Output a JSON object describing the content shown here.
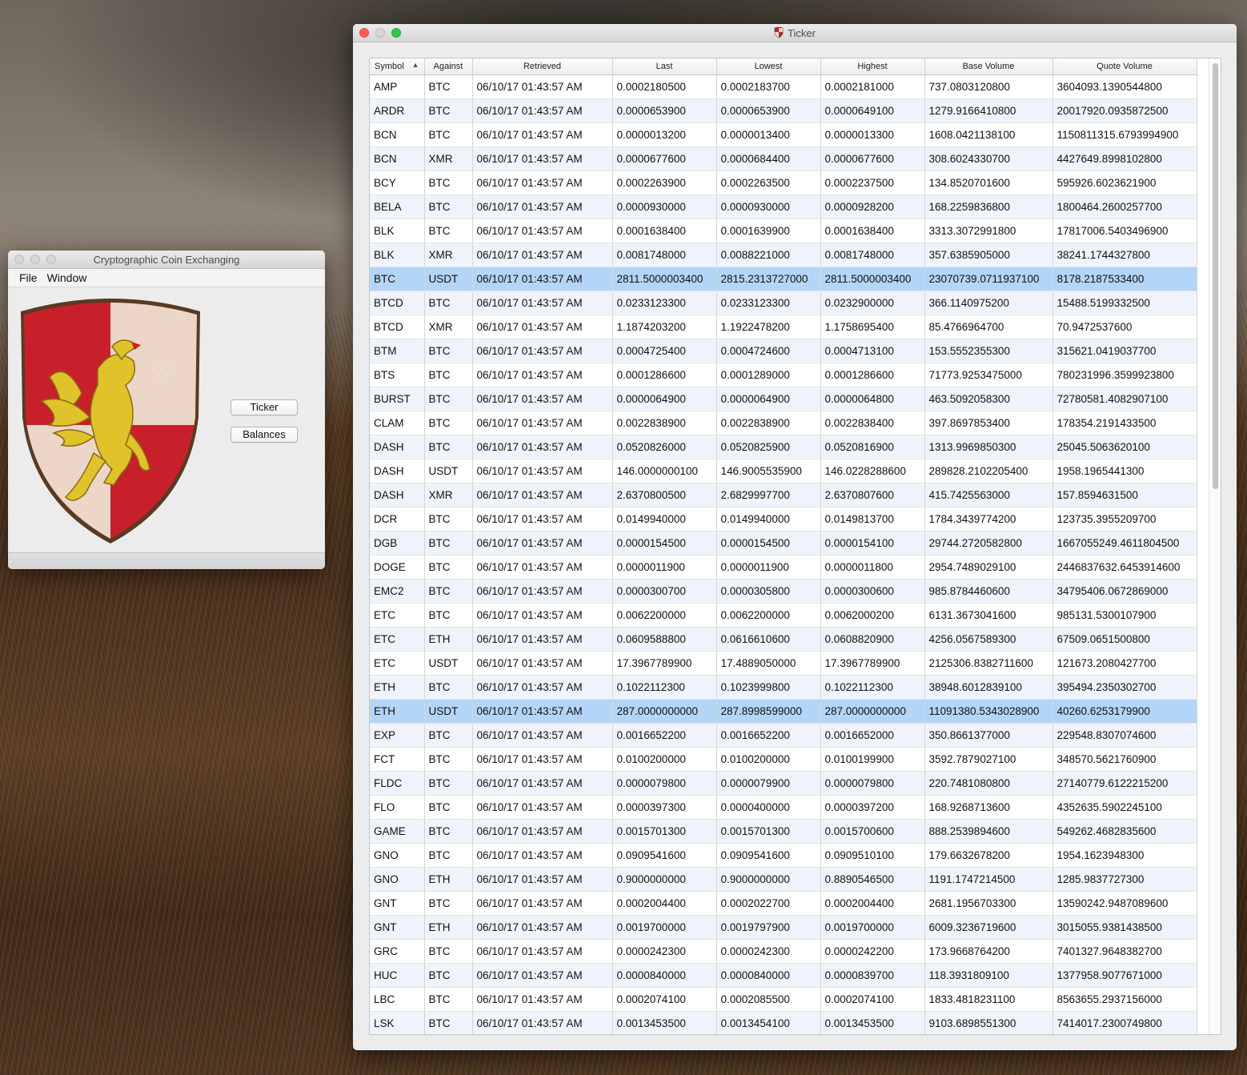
{
  "main_window": {
    "title": "Cryptographic Coin Exchanging",
    "menu": [
      "File",
      "Window"
    ],
    "buttons": {
      "ticker": "Ticker",
      "balances": "Balances"
    }
  },
  "ticker_window": {
    "title": "Ticker",
    "columns": [
      "Symbol",
      "Against",
      "Retrieved",
      "Last",
      "Lowest",
      "Highest",
      "Base Volume",
      "Quote Volume"
    ],
    "sort_indicator": "▲",
    "rows": [
      [
        "AMP",
        "BTC",
        "06/10/17 01:43:57 AM",
        "0.0002180500",
        "0.0002183700",
        "0.0002181000",
        "737.0803120800",
        "3604093.1390544800"
      ],
      [
        "ARDR",
        "BTC",
        "06/10/17 01:43:57 AM",
        "0.0000653900",
        "0.0000653900",
        "0.0000649100",
        "1279.9166410800",
        "20017920.0935872500"
      ],
      [
        "BCN",
        "BTC",
        "06/10/17 01:43:57 AM",
        "0.0000013200",
        "0.0000013400",
        "0.0000013300",
        "1608.0421138100",
        "1150811315.6793994900"
      ],
      [
        "BCN",
        "XMR",
        "06/10/17 01:43:57 AM",
        "0.0000677600",
        "0.0000684400",
        "0.0000677600",
        "308.6024330700",
        "4427649.8998102800"
      ],
      [
        "BCY",
        "BTC",
        "06/10/17 01:43:57 AM",
        "0.0002263900",
        "0.0002263500",
        "0.0002237500",
        "134.8520701600",
        "595926.6023621900"
      ],
      [
        "BELA",
        "BTC",
        "06/10/17 01:43:57 AM",
        "0.0000930000",
        "0.0000930000",
        "0.0000928200",
        "168.2259836800",
        "1800464.2600257700"
      ],
      [
        "BLK",
        "BTC",
        "06/10/17 01:43:57 AM",
        "0.0001638400",
        "0.0001639900",
        "0.0001638400",
        "3313.3072991800",
        "17817006.5403496900"
      ],
      [
        "BLK",
        "XMR",
        "06/10/17 01:43:57 AM",
        "0.0081748000",
        "0.0088221000",
        "0.0081748000",
        "357.6385905000",
        "38241.1744327800"
      ],
      [
        "BTC",
        "USDT",
        "06/10/17 01:43:57 AM",
        "2811.5000003400",
        "2815.2313727000",
        "2811.5000003400",
        "23070739.0711937100",
        "8178.2187533400"
      ],
      [
        "BTCD",
        "BTC",
        "06/10/17 01:43:57 AM",
        "0.0233123300",
        "0.0233123300",
        "0.0232900000",
        "366.1140975200",
        "15488.5199332500"
      ],
      [
        "BTCD",
        "XMR",
        "06/10/17 01:43:57 AM",
        "1.1874203200",
        "1.1922478200",
        "1.1758695400",
        "85.4766964700",
        "70.9472537600"
      ],
      [
        "BTM",
        "BTC",
        "06/10/17 01:43:57 AM",
        "0.0004725400",
        "0.0004724600",
        "0.0004713100",
        "153.5552355300",
        "315621.0419037700"
      ],
      [
        "BTS",
        "BTC",
        "06/10/17 01:43:57 AM",
        "0.0001286600",
        "0.0001289000",
        "0.0001286600",
        "71773.9253475000",
        "780231996.3599923800"
      ],
      [
        "BURST",
        "BTC",
        "06/10/17 01:43:57 AM",
        "0.0000064900",
        "0.0000064900",
        "0.0000064800",
        "463.5092058300",
        "72780581.4082907100"
      ],
      [
        "CLAM",
        "BTC",
        "06/10/17 01:43:57 AM",
        "0.0022838900",
        "0.0022838900",
        "0.0022838400",
        "397.8697853400",
        "178354.2191433500"
      ],
      [
        "DASH",
        "BTC",
        "06/10/17 01:43:57 AM",
        "0.0520826000",
        "0.0520825900",
        "0.0520816900",
        "1313.9969850300",
        "25045.5063620100"
      ],
      [
        "DASH",
        "USDT",
        "06/10/17 01:43:57 AM",
        "146.0000000100",
        "146.9005535900",
        "146.0228288600",
        "289828.2102205400",
        "1958.1965441300"
      ],
      [
        "DASH",
        "XMR",
        "06/10/17 01:43:57 AM",
        "2.6370800500",
        "2.6829997700",
        "2.6370807600",
        "415.7425563000",
        "157.8594631500"
      ],
      [
        "DCR",
        "BTC",
        "06/10/17 01:43:57 AM",
        "0.0149940000",
        "0.0149940000",
        "0.0149813700",
        "1784.3439774200",
        "123735.3955209700"
      ],
      [
        "DGB",
        "BTC",
        "06/10/17 01:43:57 AM",
        "0.0000154500",
        "0.0000154500",
        "0.0000154100",
        "29744.2720582800",
        "1667055249.4611804500"
      ],
      [
        "DOGE",
        "BTC",
        "06/10/17 01:43:57 AM",
        "0.0000011900",
        "0.0000011900",
        "0.0000011800",
        "2954.7489029100",
        "2446837632.6453914600"
      ],
      [
        "EMC2",
        "BTC",
        "06/10/17 01:43:57 AM",
        "0.0000300700",
        "0.0000305800",
        "0.0000300600",
        "985.8784460600",
        "34795406.0672869000"
      ],
      [
        "ETC",
        "BTC",
        "06/10/17 01:43:57 AM",
        "0.0062200000",
        "0.0062200000",
        "0.0062000200",
        "6131.3673041600",
        "985131.5300107900"
      ],
      [
        "ETC",
        "ETH",
        "06/10/17 01:43:57 AM",
        "0.0609588800",
        "0.0616610600",
        "0.0608820900",
        "4256.0567589300",
        "67509.0651500800"
      ],
      [
        "ETC",
        "USDT",
        "06/10/17 01:43:57 AM",
        "17.3967789900",
        "17.4889050000",
        "17.3967789900",
        "2125306.8382711600",
        "121673.2080427700"
      ],
      [
        "ETH",
        "BTC",
        "06/10/17 01:43:57 AM",
        "0.1022112300",
        "0.1023999800",
        "0.1022112300",
        "38948.6012839100",
        "395494.2350302700"
      ],
      [
        "ETH",
        "USDT",
        "06/10/17 01:43:57 AM",
        "287.0000000000",
        "287.8998599000",
        "287.0000000000",
        "11091380.5343028900",
        "40260.6253179900"
      ],
      [
        "EXP",
        "BTC",
        "06/10/17 01:43:57 AM",
        "0.0016652200",
        "0.0016652200",
        "0.0016652000",
        "350.8661377000",
        "229548.8307074600"
      ],
      [
        "FCT",
        "BTC",
        "06/10/17 01:43:57 AM",
        "0.0100200000",
        "0.0100200000",
        "0.0100199900",
        "3592.7879027100",
        "348570.5621760900"
      ],
      [
        "FLDC",
        "BTC",
        "06/10/17 01:43:57 AM",
        "0.0000079800",
        "0.0000079900",
        "0.0000079800",
        "220.7481080800",
        "27140779.6122215200"
      ],
      [
        "FLO",
        "BTC",
        "06/10/17 01:43:57 AM",
        "0.0000397300",
        "0.0000400000",
        "0.0000397200",
        "168.9268713600",
        "4352635.5902245100"
      ],
      [
        "GAME",
        "BTC",
        "06/10/17 01:43:57 AM",
        "0.0015701300",
        "0.0015701300",
        "0.0015700600",
        "888.2539894600",
        "549262.4682835600"
      ],
      [
        "GNO",
        "BTC",
        "06/10/17 01:43:57 AM",
        "0.0909541600",
        "0.0909541600",
        "0.0909510100",
        "179.6632678200",
        "1954.1623948300"
      ],
      [
        "GNO",
        "ETH",
        "06/10/17 01:43:57 AM",
        "0.9000000000",
        "0.9000000000",
        "0.8890546500",
        "1191.1747214500",
        "1285.9837727300"
      ],
      [
        "GNT",
        "BTC",
        "06/10/17 01:43:57 AM",
        "0.0002004400",
        "0.0002022700",
        "0.0002004400",
        "2681.1956703300",
        "13590242.9487089600"
      ],
      [
        "GNT",
        "ETH",
        "06/10/17 01:43:57 AM",
        "0.0019700000",
        "0.0019797900",
        "0.0019700000",
        "6009.3236719600",
        "3015055.9381438500"
      ],
      [
        "GRC",
        "BTC",
        "06/10/17 01:43:57 AM",
        "0.0000242300",
        "0.0000242300",
        "0.0000242200",
        "173.9668764200",
        "7401327.9648382700"
      ],
      [
        "HUC",
        "BTC",
        "06/10/17 01:43:57 AM",
        "0.0000840000",
        "0.0000840000",
        "0.0000839700",
        "118.3931809100",
        "1377958.9077671000"
      ],
      [
        "LBC",
        "BTC",
        "06/10/17 01:43:57 AM",
        "0.0002074100",
        "0.0002085500",
        "0.0002074100",
        "1833.4818231100",
        "8563655.2937156000"
      ],
      [
        "LSK",
        "BTC",
        "06/10/17 01:43:57 AM",
        "0.0013453500",
        "0.0013454100",
        "0.0013453500",
        "9103.6898551300",
        "7414017.2300749800"
      ]
    ],
    "selected_rows": [
      8,
      26
    ]
  }
}
